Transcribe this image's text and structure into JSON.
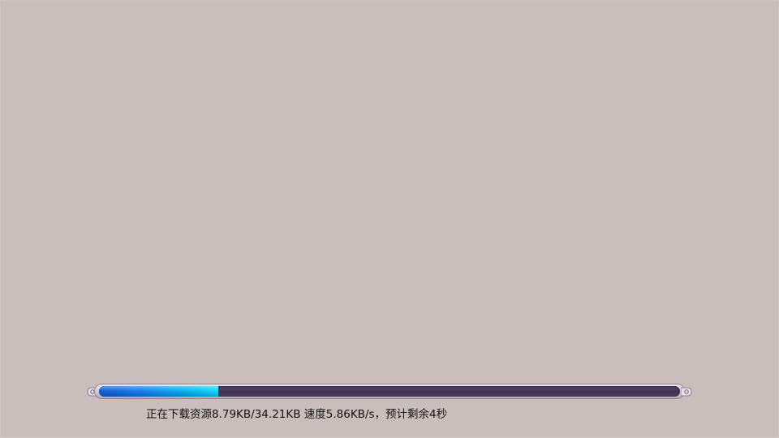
{
  "loading": {
    "progress_fraction": 0.2055,
    "status": "正在下载资源8.79KB/34.21KB 速度5.86KB/s，预计剩余4秒"
  },
  "colors": {
    "background": "#c9bebb",
    "track": "#3f3250",
    "fill_start": "#1560d0",
    "fill_end": "#14dcff",
    "text": "#111111"
  },
  "icons": {
    "left_cap": "bar-end-cap-icon",
    "right_cap": "bar-end-cap-icon"
  }
}
